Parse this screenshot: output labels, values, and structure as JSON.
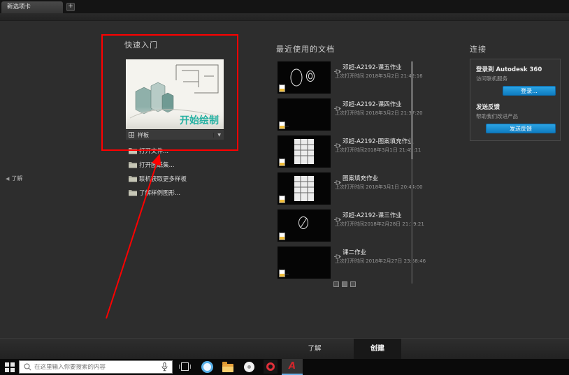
{
  "window": {
    "tab_title": "新选项卡",
    "new_tab_button": "+"
  },
  "icons": {
    "dropdown_arrow": "▼",
    "flyout_arrow": "◀",
    "autocad_glyph": "A"
  },
  "flyout": {
    "label": "了解"
  },
  "quick_start": {
    "title": "快速入门",
    "start_drawing": "开始绘制",
    "template_label": "样板",
    "links": [
      {
        "label": "打开文件...",
        "icon": "open-file-icon"
      },
      {
        "label": "打开图纸集...",
        "icon": "open-sheet-set-icon"
      },
      {
        "label": "联机获取更多样板",
        "icon": "online-templates-icon"
      },
      {
        "label": "了解样例图形...",
        "icon": "sample-drawings-icon"
      }
    ]
  },
  "recent_docs": {
    "title": "最近使用的文档",
    "items": [
      {
        "title": "邓超-A2192-课五作业",
        "subtitle": "上次打开时间 2018年3月2日 21:42:16",
        "thumb": "circles"
      },
      {
        "title": "邓超-A2192-课四作业",
        "subtitle": "上次打开时间 2018年3月2日 21:37:20",
        "thumb": "blank"
      },
      {
        "title": "邓超-A2192-图案填充作业",
        "subtitle": "上次打开时间2018年3月1日 21:45:11",
        "thumb": "plan"
      },
      {
        "title": "图案填充作业",
        "subtitle": "上次打开时间 2018年3月1日 20:44:00",
        "thumb": "plan"
      },
      {
        "title": "邓超-A2192-课三作业",
        "subtitle": "上次打开时间2018年2月28日 21:19:21",
        "thumb": "circle"
      },
      {
        "title": "课二作业",
        "subtitle": "上次打开时间 2018年2月27日 23:58:46",
        "thumb": "blank"
      }
    ]
  },
  "connect": {
    "title": "连接",
    "sign_in_title": "登录到 Autodesk 360",
    "sign_in_subtitle": "访问联机服务",
    "sign_in_button": "登录...",
    "feedback_title": "发送反馈",
    "feedback_subtitle": "帮助我们改进产品",
    "feedback_button": "发送反馈"
  },
  "bottom_tabs": {
    "learn": "了解",
    "create": "创建",
    "active": "创建"
  },
  "taskbar": {
    "search_placeholder": "在这里输入你要搜索的内容"
  },
  "colors": {
    "accent_blue": "#1e8fd5",
    "annotation_red": "#ff0000",
    "teal": "#23b0a1"
  }
}
